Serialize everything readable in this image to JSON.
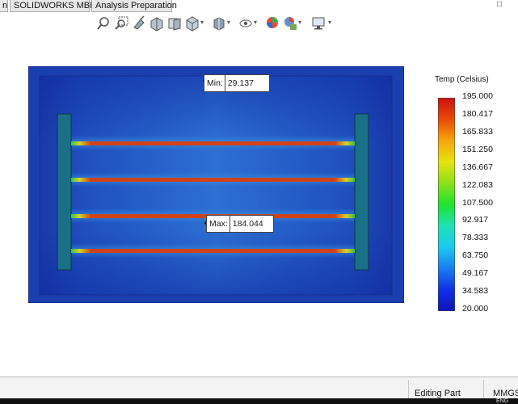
{
  "tabs": [
    {
      "label": "n"
    },
    {
      "label": "SOLIDWORKS MBD"
    },
    {
      "label": "Analysis Preparation"
    }
  ],
  "window": {
    "restore_glyph": "□"
  },
  "toolbar": {
    "icons": [
      "zoom-to-fit-icon",
      "zoom-to-area-icon",
      "previous-view-icon",
      "section-view-icon",
      "dynamic-annotation-icon",
      "view-orientation-icon",
      "display-style-icon",
      "hide-show-icon",
      "edit-appearance-icon",
      "apply-scene-icon",
      "view-settings-icon"
    ],
    "dropdown_glyph": "▾"
  },
  "probes": {
    "min": {
      "label": "Min:",
      "value": "29.137"
    },
    "max": {
      "label": "Max:",
      "value": "184.044"
    }
  },
  "legend": {
    "title": "Temp (Celsius)",
    "ticks": [
      "195.000",
      "180.417",
      "165.833",
      "151.250",
      "136.667",
      "122.083",
      "107.500",
      "92.917",
      "78.333",
      "63.750",
      "49.167",
      "34.583",
      "20.000"
    ],
    "colors": [
      "#cc1010",
      "#e84a08",
      "#f7a50c",
      "#e6e30c",
      "#8fe01a",
      "#1ee32e",
      "#1ee3b4",
      "#1cc9f0",
      "#1a7ef0",
      "#1230e6",
      "#0d14b8"
    ]
  },
  "plot": {
    "colors": {
      "outer": "#1a3fb5",
      "inner_edge": "#1d3aa6",
      "inner_mid": "#2a62c9",
      "post": "#1a6e8a",
      "wire": "#c83a16",
      "wire_tip": "#4cc23a"
    }
  },
  "status": {
    "mode": "Editing Part",
    "units": "MMGS",
    "tray": "ENG"
  }
}
